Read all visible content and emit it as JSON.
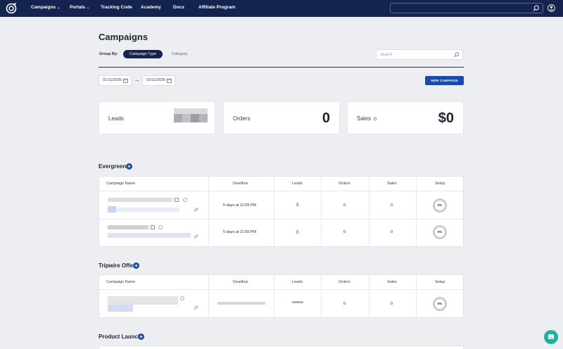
{
  "nav": {
    "items": [
      {
        "label": "Campaigns",
        "has_dropdown": true
      },
      {
        "label": "Portals",
        "has_dropdown": true
      },
      {
        "label": "Tracking Code",
        "has_dropdown": false
      },
      {
        "label": "Academy",
        "has_dropdown": false
      },
      {
        "label": "Docs",
        "has_dropdown": false
      },
      {
        "label": "Affiliate Program",
        "has_dropdown": false
      }
    ],
    "search_value": ""
  },
  "page": {
    "title": "Campaigns",
    "group_by_label": "Group By:",
    "group_by_options": [
      "Campaign Type",
      "Category"
    ],
    "group_by_selected": "Campaign Type",
    "search_placeholder": "Search",
    "date_start": "01/11/2025",
    "date_end": "02/11/2025",
    "new_campaign_label": "NEW CAMPAIGN"
  },
  "stats": {
    "leads_label": "Leads",
    "orders_label": "Orders",
    "orders_value": "0",
    "sales_label": "Sales",
    "sales_value": "$0"
  },
  "table_headers": [
    "Campaign Name",
    "Deadline",
    "Leads",
    "Orders",
    "Sales",
    "Setup"
  ],
  "sections": [
    {
      "title": "Evergreen",
      "rows": [
        {
          "deadline": "5 days at 11:59 PM",
          "leads": "5",
          "orders": "0",
          "sales": "0",
          "setup": "0%"
        },
        {
          "deadline": "5 days at 11:59 PM",
          "leads": "0",
          "orders": "0",
          "sales": "0",
          "setup": "0%"
        }
      ]
    },
    {
      "title": "Tripwire Offer",
      "rows": [
        {
          "deadline": "",
          "leads": "",
          "orders": "0",
          "sales": "0",
          "setup": "0%"
        }
      ]
    },
    {
      "title": "Product Launch",
      "rows": []
    }
  ],
  "colors": {
    "nav_bg": "#14244f",
    "accent": "#1c4aa8",
    "page_bg": "#eceef2",
    "chat": "#1fb29c"
  }
}
